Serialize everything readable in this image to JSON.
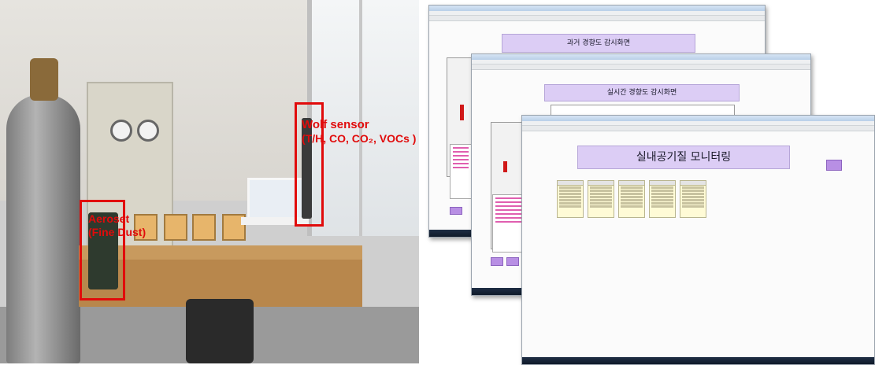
{
  "labels": {
    "wolf_line1": "Wolf sensor",
    "wolf_line2": "(T/H, CO, CO₂, VOCs )",
    "aero_line1": "Aeroset",
    "aero_line2": "(Fine Dust)"
  },
  "windows": {
    "back_title": "과거 경향도 감시화면",
    "middle_title": "실시간 경향도 감시화면",
    "front_title": "실내공기질 모니터링"
  },
  "colors": {
    "highlight": "#e10b0b",
    "title_box": "#dccdf5",
    "accent_button": "#b88fe4",
    "bar": "#d01818"
  }
}
